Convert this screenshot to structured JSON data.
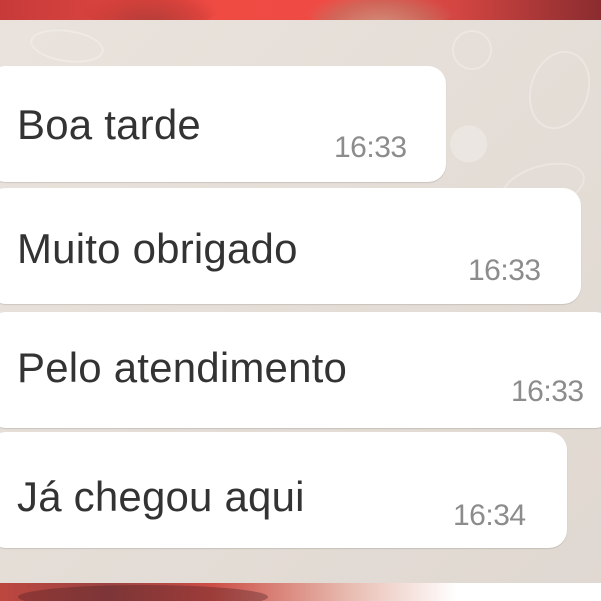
{
  "messages": [
    {
      "text": "Boa tarde",
      "time": "16:33"
    },
    {
      "text": "Muito obrigado",
      "time": "16:33"
    },
    {
      "text": "Pelo atendimento",
      "time": "16:33"
    },
    {
      "text": "Já chegou aqui",
      "time": "16:34"
    }
  ],
  "colors": {
    "bubble": "#ffffff",
    "chat_background": "#e7dfd8",
    "message_text": "#333333",
    "timestamp": "#8c8c8c",
    "top_strip": "#ef4b43"
  }
}
